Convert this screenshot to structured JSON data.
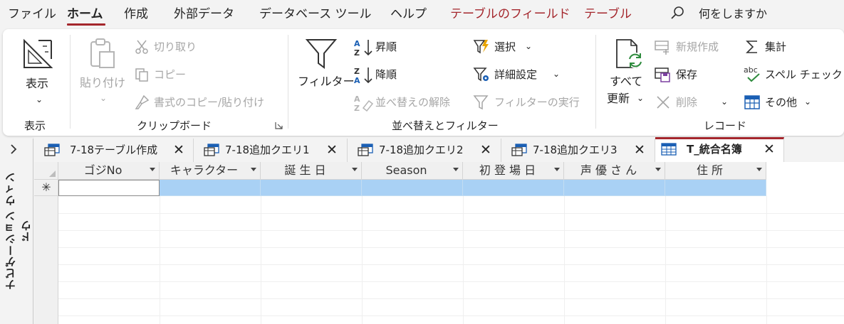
{
  "menubar": {
    "tabs": [
      {
        "label": "ファイル",
        "state": "normal"
      },
      {
        "label": "ホーム",
        "state": "active"
      },
      {
        "label": "作成",
        "state": "normal"
      },
      {
        "label": "外部データ",
        "state": "normal"
      },
      {
        "label": "データベース ツール",
        "state": "normal"
      },
      {
        "label": "ヘルプ",
        "state": "normal"
      },
      {
        "label": "テーブルのフィールド",
        "state": "contextual"
      },
      {
        "label": "テーブル",
        "state": "contextual"
      }
    ],
    "search_label": "何をしますか",
    "accent_color": "#a4262c"
  },
  "ribbon": {
    "view": {
      "button_label": "表示",
      "group_label": "表示"
    },
    "clipboard": {
      "paste_label": "貼り付け",
      "cut_label": "切り取り",
      "copy_label": "コピー",
      "format_painter_label": "書式のコピー/貼り付け",
      "group_label": "クリップボード"
    },
    "sort_filter": {
      "filter_label": "フィルター",
      "ascending_label": "昇順",
      "descending_label": "降順",
      "remove_sort_label": "並べ替えの解除",
      "selection_label": "選択",
      "advanced_label": "詳細設定",
      "toggle_filter_label": "フィルターの実行",
      "group_label": "並べ替えとフィルター"
    },
    "records": {
      "refresh_line1": "すべて",
      "refresh_line2": "更新",
      "new_label": "新規作成",
      "save_label": "保存",
      "delete_label": "削除",
      "totals_label": "集計",
      "spelling_label": "スペル チェック",
      "more_label": "その他",
      "group_label": "レコード"
    }
  },
  "nav_pane": {
    "label": "ナビゲーション ウィンドウ"
  },
  "doc_tabs": [
    {
      "label": "7-18テーブル作成",
      "active": false
    },
    {
      "label": "7-18追加クエリ1",
      "active": false
    },
    {
      "label": "7-18追加クエリ2",
      "active": false
    },
    {
      "label": "7-18追加クエリ3",
      "active": false
    },
    {
      "label": "T_統合名簿",
      "active": true
    }
  ],
  "datasheet": {
    "columns": [
      "ゴジNo",
      "キャラクター",
      "誕 生 日",
      "Season",
      "初 登 場 日",
      "声 優 さ ん",
      "住 所"
    ],
    "new_record_marker": "✳",
    "rows": []
  }
}
